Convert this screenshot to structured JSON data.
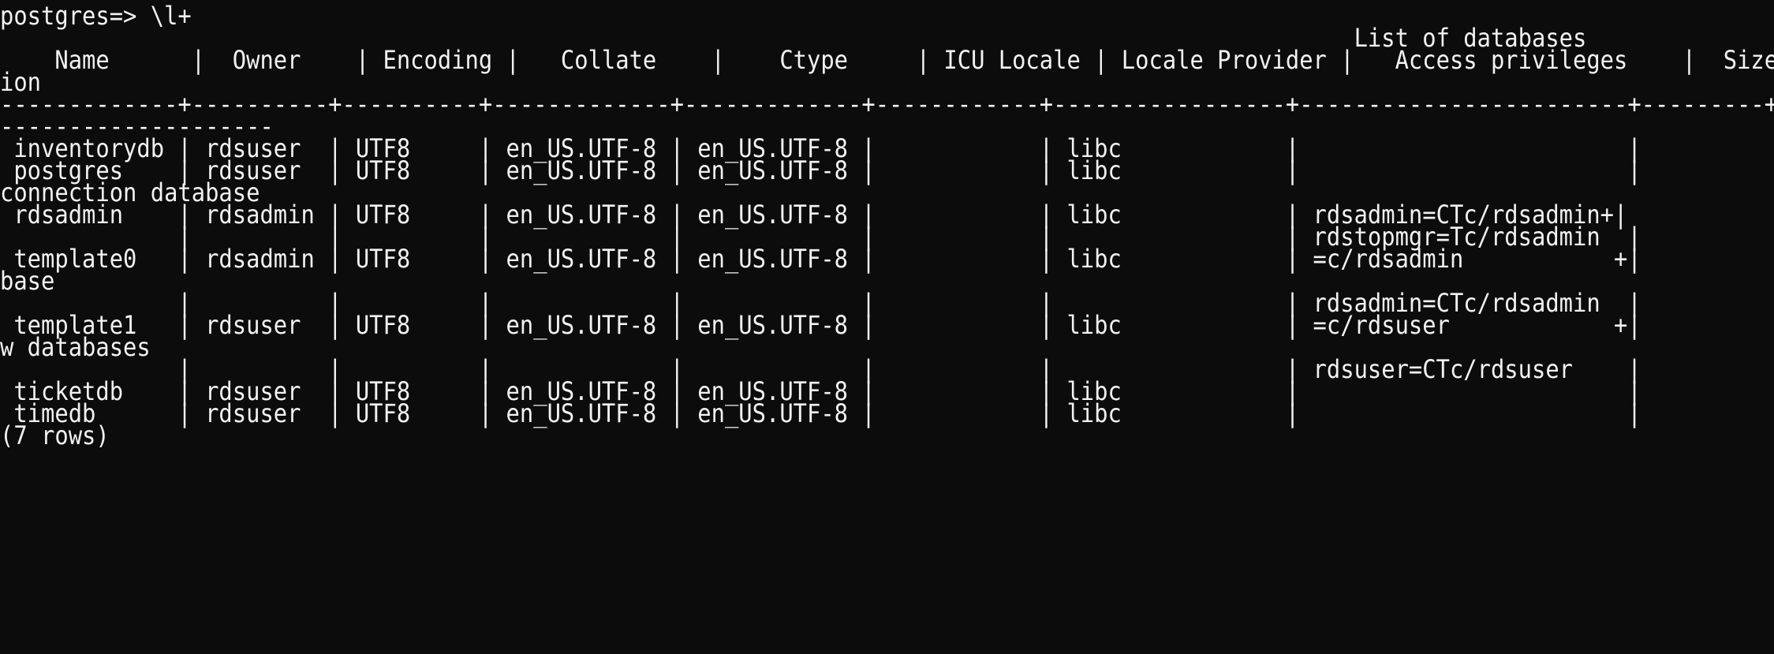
{
  "terminal": {
    "lines": [
      "postgres=> \\l+",
      "                                                                                                   List of databases",
      "    Name      |  Owner    | Encoding |   Collate    |    Ctype     | ICU Locale | Locale Provider |   Access privileges    |  Size   | Tablespace |                Descript",
      "ion",
      "-------------+----------+----------+-------------+-------------+------------+-----------------+------------------------+---------+------------+---------------------------",
      "--------------------",
      " inventorydb | rdsuser  | UTF8     | en_US.UTF-8 | en_US.UTF-8 |            | libc            |                        |",
      " postgres    | rdsuser  | UTF8     | en_US.UTF-8 | en_US.UTF-8 |            | libc            |                        |",
      "connection database",
      " rdsadmin    | rdsadmin | UTF8     | en_US.UTF-8 | en_US.UTF-8 |            | libc            | rdsadmin=CTc/rdsadmin+|",
      "             |          |          |             |             |            |                 | rdstopmgr=Tc/rdsadmin  |",
      " template0   | rdsadmin | UTF8     | en_US.UTF-8 | en_US.UTF-8 |            | libc            | =c/rdsadmin           +|",
      "base",
      "             |          |          |             |             |            |                 | rdsadmin=CTc/rdsadmin  |",
      " template1   | rdsuser  | UTF8     | en_US.UTF-8 | en_US.UTF-8 |            | libc            | =c/rdsuser            +|",
      "w databases",
      "             |          |          |             |             |            |                 | rdsuser=CTc/rdsuser    |",
      " ticketdb    | rdsuser  | UTF8     | en_US.UTF-8 | en_US.UTF-8 |            | libc            |                        |",
      " timedb      | rdsuser  | UTF8     | en_US.UTF-8 | en_US.UTF-8 |            | libc            |                        |",
      "(7 rows)"
    ]
  }
}
